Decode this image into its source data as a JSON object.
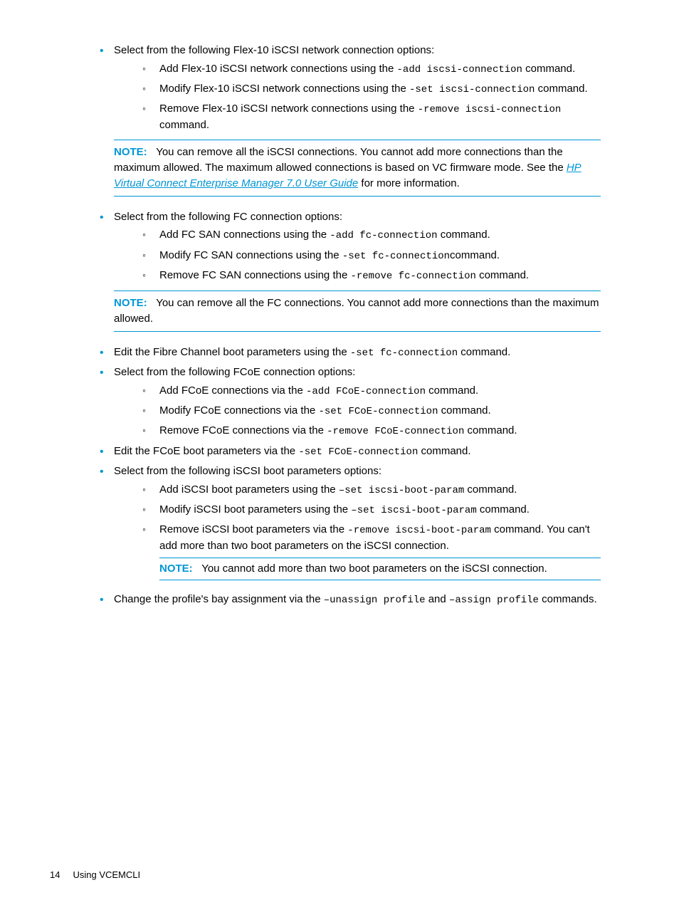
{
  "sections": [
    {
      "intro": "Select from the following Flex-10 iSCSI network connection options:",
      "items": [
        {
          "pre": "Add Flex-10 iSCSI network connections using the ",
          "code": "-add iscsi-connection",
          "post": " command."
        },
        {
          "pre": "Modify Flex-10 iSCSI network connections using the ",
          "code": "-set iscsi-connection",
          "post": " command."
        },
        {
          "pre": "Remove Flex-10 iSCSI network connections using the ",
          "code": "-remove iscsi-connection",
          "post": " command."
        }
      ],
      "note": {
        "label": "NOTE:",
        "pre": "You can remove all the iSCSI connections. You cannot add more connections than the maximum allowed. The maximum allowed connections is based on VC firmware mode. See the ",
        "link": "HP Virtual Connect Enterprise Manager 7.0 User Guide",
        "post": " for more information."
      }
    },
    {
      "intro": "Select from the following FC connection options:",
      "items": [
        {
          "pre": "Add FC SAN connections using the ",
          "code": "-add fc-connection",
          "post": " command."
        },
        {
          "pre": "Modify FC SAN connections using the ",
          "code": "-set fc-connection",
          "post": "command."
        },
        {
          "pre": "Remove FC SAN connections using the ",
          "code": "-remove fc-connection",
          "post": " command."
        }
      ],
      "note": {
        "label": "NOTE:",
        "pre": "You can remove all the FC connections. You cannot add more connections than the maximum allowed.",
        "link": "",
        "post": ""
      }
    },
    {
      "single": {
        "pre": "Edit the Fibre Channel boot parameters using the ",
        "code": "-set fc-connection",
        "post": " command."
      }
    },
    {
      "intro": "Select from the following FCoE connection options:",
      "items": [
        {
          "pre": "Add FCoE connections via the  ",
          "code": "-add FCoE-connection",
          "post": " command."
        },
        {
          "pre": "Modify FCoE connections via the ",
          "code": "-set FCoE-connection",
          "post": " command."
        },
        {
          "pre": "Remove FCoE connections via the ",
          "code": "-remove FCoE-connection",
          "post": " command."
        }
      ]
    },
    {
      "single": {
        "pre": "Edit the FCoE boot parameters via the ",
        "code": "-set FCoE-connection",
        "post": " command."
      }
    },
    {
      "intro": "Select from the following iSCSI boot parameters options:",
      "items": [
        {
          "pre": "Add iSCSI boot parameters using the ",
          "code": "–set iscsi-boot-param",
          "post": " command."
        },
        {
          "pre": "Modify iSCSI boot parameters using the ",
          "code": "–set iscsi-boot-param",
          "post": " command."
        },
        {
          "pre": "Remove iSCSI boot parameters via the ",
          "code": "-remove iscsi-boot-param",
          "post": " command. You can't add more than two boot parameters on the iSCSI connection.",
          "innerNote": {
            "label": "NOTE:",
            "text": "You cannot add more than two boot parameters on the iSCSI connection."
          }
        }
      ]
    },
    {
      "single": {
        "pre": "Change the profile's bay assignment via the ",
        "code": "–unassign profile",
        "mid": " and ",
        "code2": "–assign profile",
        "post": " commands."
      }
    }
  ],
  "footer": {
    "page": "14",
    "title": "Using VCEMCLI"
  }
}
